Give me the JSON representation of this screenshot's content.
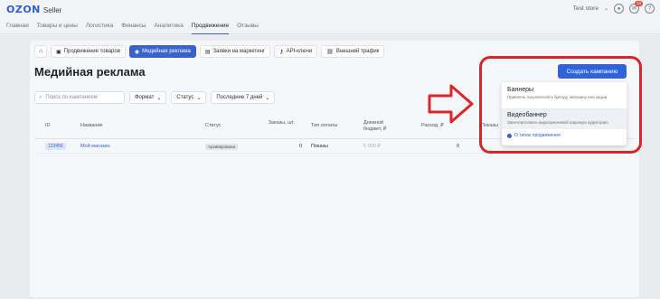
{
  "header": {
    "logo_brand": "OZON",
    "logo_product": "Seller",
    "store_name": "Test store",
    "notifications_count": "10"
  },
  "nav": {
    "items": [
      "Главная",
      "Товары и цены",
      "Логистика",
      "Финансы",
      "Аналитика",
      "Продвижение",
      "Отзывы"
    ],
    "active": "Продвижение"
  },
  "subnav": {
    "items": [
      "Продвижение товаров",
      "Медийная реклама",
      "Заявки на маркетинг",
      "API-ключи",
      "Внешний трафик"
    ],
    "active": "Медийная реклама"
  },
  "page_title": "Медийная реклама",
  "create_button": "Создать кампанию",
  "filters": {
    "search_placeholder": "Поиск по кампаниям",
    "format": "Формат",
    "status": "Статус",
    "period": "Последние 7 дней"
  },
  "table": {
    "columns": [
      "ID",
      "Название",
      "Статус",
      "Заказы, шт.",
      "Тип оплаты",
      "Дневной бюджет, ₽",
      "Расход, ₽",
      "Показы"
    ],
    "rows": [
      {
        "id": "123456",
        "name": "Мой магазин",
        "status": "Архивирована",
        "orders": "0",
        "payment_type": "Показы",
        "daily_budget": "5 000 ₽",
        "spend": "0"
      }
    ]
  },
  "dropdown": {
    "items": [
      {
        "title": "Баннеры",
        "description": "Привлечь покупателей к бренду, магазину или акции"
      },
      {
        "title": "Видеобаннер",
        "description": "Заинтересовать видеорекламой широкую аудиторию"
      }
    ],
    "footer_link": "О типах продвижения"
  },
  "colors": {
    "accent": "#2f63dd",
    "highlight": "#d8262c"
  }
}
